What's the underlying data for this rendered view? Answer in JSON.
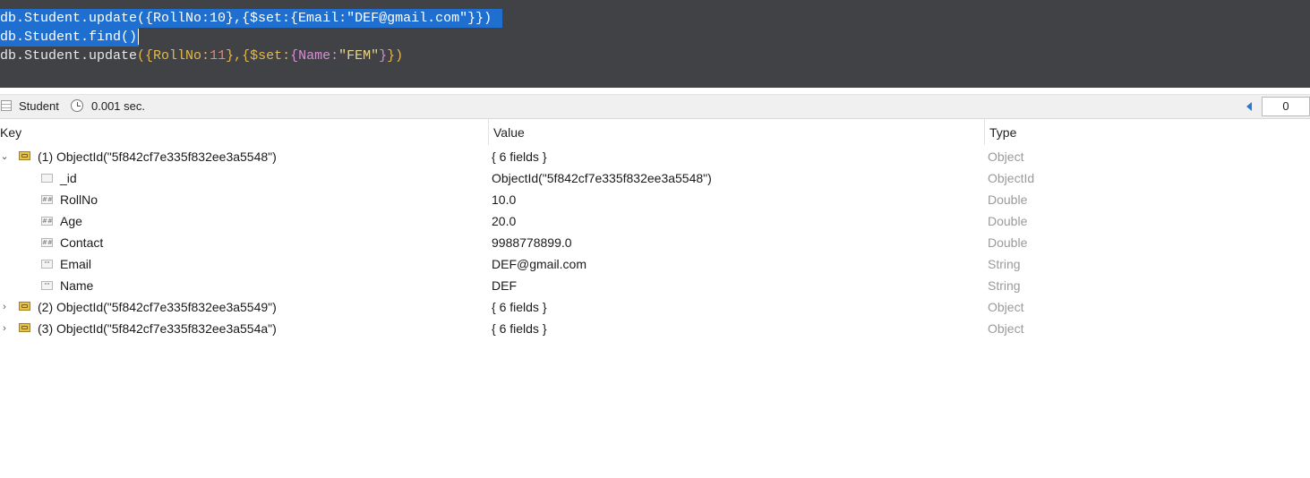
{
  "editor": {
    "lines": [
      {
        "segments": [
          {
            "text": "db.Student.update(",
            "cls": "sel"
          },
          {
            "text": "{RollNo:10},{$set:{Email:\"DEF@gmail.com\"}})",
            "cls": "sel"
          }
        ]
      },
      {
        "segments": [
          {
            "text": "db.Student.find()",
            "cls": "sel"
          }
        ]
      },
      {
        "segments": [
          {
            "text": "db.Student.update",
            "cls": "db"
          },
          {
            "text": "({",
            "cls": "p1"
          },
          {
            "text": "RollNo:",
            "cls": "p1"
          },
          {
            "text": "11",
            "cls": "num"
          },
          {
            "text": "},{",
            "cls": "p1"
          },
          {
            "text": "$set:",
            "cls": "p1"
          },
          {
            "text": "{",
            "cls": "p2"
          },
          {
            "text": "Name:",
            "cls": "p2"
          },
          {
            "text": "\"FEM\"",
            "cls": "str"
          },
          {
            "text": "}",
            "cls": "p2"
          },
          {
            "text": "})",
            "cls": "p1"
          }
        ]
      }
    ]
  },
  "result_bar": {
    "collection": "Student",
    "exec_time": "0.001 sec.",
    "page_value": "0"
  },
  "grid": {
    "columns": [
      "Key",
      "Value",
      "Type"
    ],
    "rows": [
      {
        "level": 0,
        "expander": "⌄",
        "icon": "object",
        "key": "(1) ObjectId(\"5f842cf7e335f832ee3a5548\")",
        "value": "{ 6 fields }",
        "type": "Object"
      },
      {
        "level": 1,
        "expander": "",
        "icon": "field-blank",
        "key": "_id",
        "value": "ObjectId(\"5f842cf7e335f832ee3a5548\")",
        "type": "ObjectId"
      },
      {
        "level": 1,
        "expander": "",
        "icon": "field-number",
        "key": "RollNo",
        "value": "10.0",
        "type": "Double"
      },
      {
        "level": 1,
        "expander": "",
        "icon": "field-number",
        "key": "Age",
        "value": "20.0",
        "type": "Double"
      },
      {
        "level": 1,
        "expander": "",
        "icon": "field-number",
        "key": "Contact",
        "value": "9988778899.0",
        "type": "Double"
      },
      {
        "level": 1,
        "expander": "",
        "icon": "field-string",
        "key": "Email",
        "value": "DEF@gmail.com",
        "type": "String"
      },
      {
        "level": 1,
        "expander": "",
        "icon": "field-string",
        "key": "Name",
        "value": "DEF",
        "type": "String"
      },
      {
        "level": 0,
        "expander": "›",
        "icon": "object",
        "key": "(2) ObjectId(\"5f842cf7e335f832ee3a5549\")",
        "value": "{ 6 fields }",
        "type": "Object"
      },
      {
        "level": 0,
        "expander": "›",
        "icon": "object",
        "key": "(3) ObjectId(\"5f842cf7e335f832ee3a554a\")",
        "value": "{ 6 fields }",
        "type": "Object"
      }
    ]
  }
}
